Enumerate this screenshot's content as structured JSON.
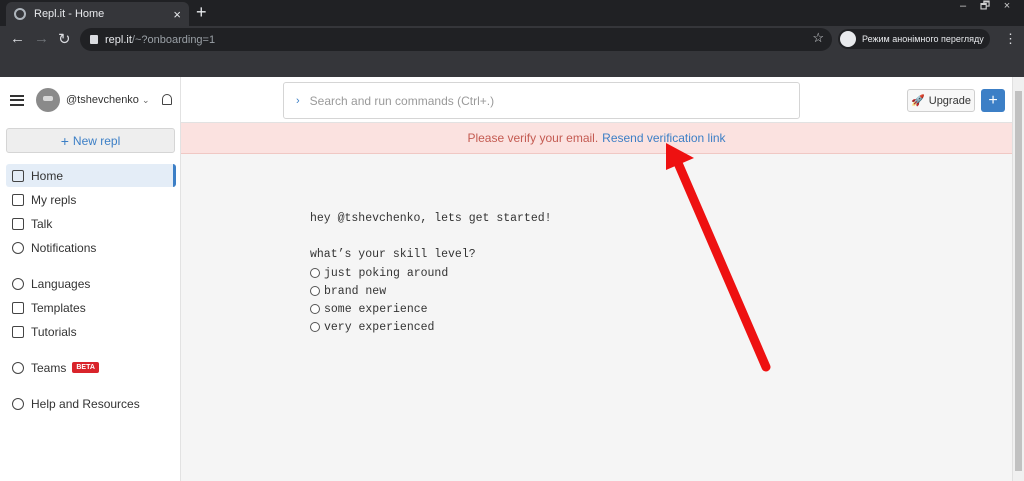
{
  "browser": {
    "tab_title": "Repl.it - Home",
    "tab_close": "×",
    "new_tab": "+",
    "url_host": "repl.it",
    "url_path": "/~?onboarding=1",
    "incognito_label": "Режим анонімного перегляду",
    "window_controls": [
      "–",
      "🗗",
      "×"
    ]
  },
  "sidebar": {
    "username": "@tshevchenko",
    "new_repl_label": "New repl",
    "items": [
      {
        "label": "Home",
        "icon": "home-icon"
      },
      {
        "label": "My repls",
        "icon": "folder-icon"
      },
      {
        "label": "Talk",
        "icon": "talk-icon"
      },
      {
        "label": "Notifications",
        "icon": "bell-icon"
      },
      {
        "label": "Languages",
        "icon": "globe-icon"
      },
      {
        "label": "Templates",
        "icon": "templates-icon"
      },
      {
        "label": "Tutorials",
        "icon": "book-icon"
      },
      {
        "label": "Teams",
        "icon": "users-icon",
        "badge": "BETA"
      },
      {
        "label": "Help and Resources",
        "icon": "info-icon"
      }
    ]
  },
  "topbar": {
    "search_placeholder": "Search and run commands (Ctrl+.)",
    "upgrade_label": "Upgrade",
    "plus_label": "+"
  },
  "banner": {
    "message": "Please verify your email.",
    "link": "Resend verification link"
  },
  "onboarding": {
    "greeting": "hey @tshevchenko, lets get started!",
    "question": "what’s your skill level?",
    "options": [
      "just poking around",
      "brand new",
      "some experience",
      "very experienced"
    ]
  },
  "colors": {
    "accent": "#3c7fc6",
    "banner_bg": "#fbe2e0",
    "annotation_arrow": "#ee1111"
  }
}
